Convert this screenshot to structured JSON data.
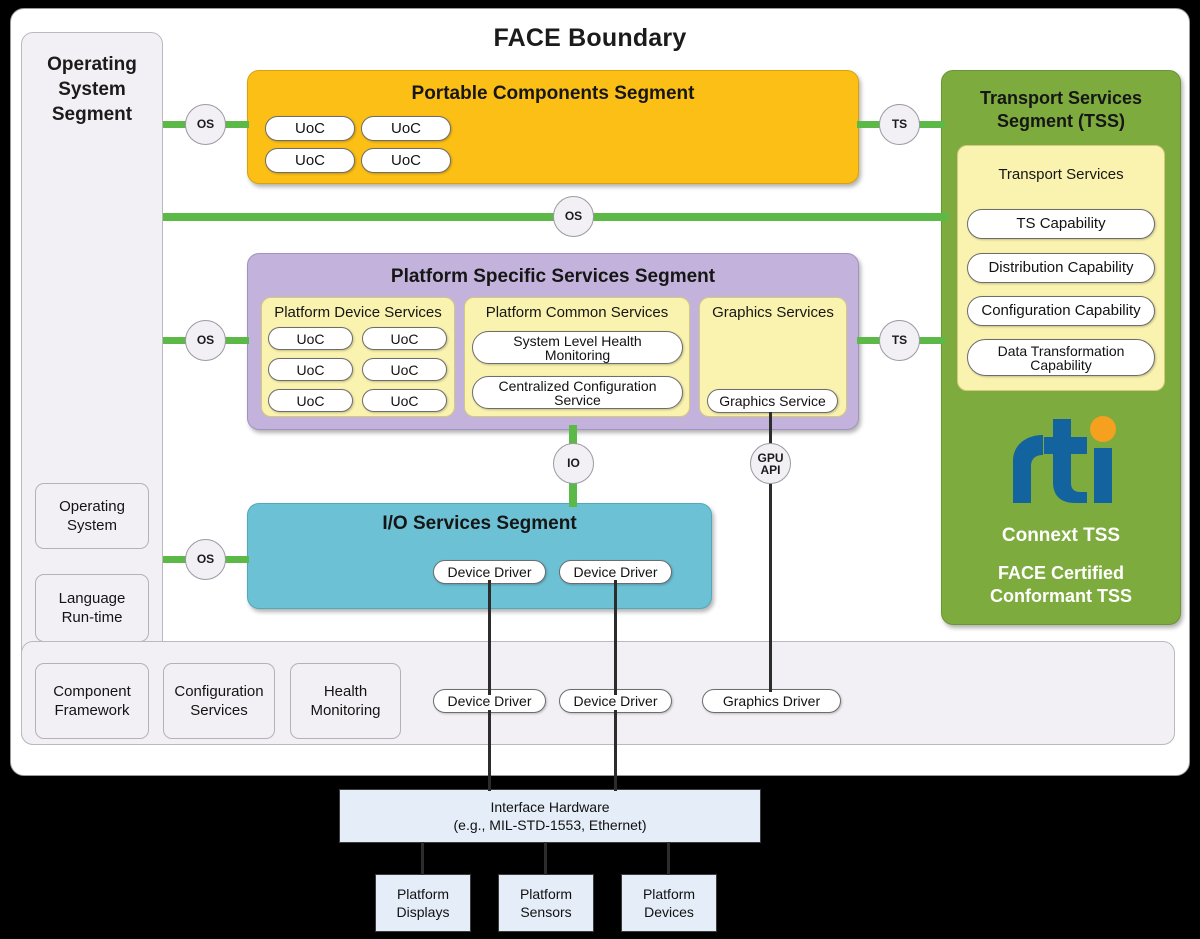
{
  "diagram": {
    "title": "FACE Boundary"
  },
  "operating_system_segment": {
    "title": "Operating\nSystem\nSegment",
    "title_line1": "Operating",
    "title_line2": "System",
    "title_line3": "Segment",
    "upper_items": [
      {
        "label": "Operating System",
        "line1": "Operating",
        "line2": "System"
      },
      {
        "label": "Language Run-time",
        "line1": "Language",
        "line2": "Run-time"
      }
    ],
    "bottom_items": [
      {
        "label": "Component Framework",
        "line1": "Component",
        "line2": "Framework"
      },
      {
        "label": "Configuration Services",
        "line1": "Configuration",
        "line2": "Services"
      },
      {
        "label": "Health Monitoring",
        "line1": "Health",
        "line2": "Monitoring"
      }
    ],
    "drivers": [
      {
        "label": "Device Driver"
      },
      {
        "label": "Device Driver"
      },
      {
        "label": "Graphics Driver"
      }
    ]
  },
  "portable_components_segment": {
    "title": "Portable Components Segment",
    "color": "#FCBF16",
    "uocs": [
      {
        "label": "UoC"
      },
      {
        "label": "UoC"
      },
      {
        "label": "UoC"
      },
      {
        "label": "UoC"
      }
    ]
  },
  "platform_specific_services_segment": {
    "title": "Platform Specific Services Segment",
    "color": "#C3B3DC",
    "groups": [
      {
        "title": "Platform Device Services",
        "items": [
          {
            "label": "UoC"
          },
          {
            "label": "UoC"
          },
          {
            "label": "UoC"
          },
          {
            "label": "UoC"
          },
          {
            "label": "UoC"
          },
          {
            "label": "UoC"
          }
        ]
      },
      {
        "title": "Platform Common Services",
        "items": [
          {
            "label": "System Level Health Monitoring",
            "line1": "System Level Health",
            "line2": "Monitoring"
          },
          {
            "label": "Centralized Configuration Service",
            "line1": "Centralized Configuration",
            "line2": "Service"
          }
        ]
      },
      {
        "title": "Graphics Services",
        "items": [
          {
            "label": "Graphics Service"
          }
        ]
      }
    ]
  },
  "io_services_segment": {
    "title": "I/O Services Segment",
    "color": "#6DC1D5",
    "drivers": [
      {
        "label": "Device Driver"
      },
      {
        "label": "Device Driver"
      }
    ]
  },
  "transport_services_segment": {
    "title_line1": "Transport Services",
    "title_line2": "Segment (TSS)",
    "color": "#7EAB3E",
    "inner_group_title": "Transport Services",
    "capabilities": [
      {
        "label": "TS Capability"
      },
      {
        "label": "Distribution Capability"
      },
      {
        "label": "Configuration Capability"
      },
      {
        "label": "Data Transformation Capability",
        "line1": "Data Transformation",
        "line2": "Capability"
      }
    ],
    "logo": {
      "name": "rti-logo",
      "wordmark": "rti",
      "blue": "#12639E",
      "orange": "#F5A01E"
    },
    "product_name": "Connext TSS",
    "certification_line1": "FACE Certified",
    "certification_line2": "Conformant TSS"
  },
  "connectors": [
    {
      "id": "os-portable",
      "label": "OS"
    },
    {
      "id": "os-bus",
      "label": "OS"
    },
    {
      "id": "os-pss",
      "label": "OS"
    },
    {
      "id": "os-io",
      "label": "OS"
    },
    {
      "id": "ts-portable",
      "label": "TS"
    },
    {
      "id": "ts-pss",
      "label": "TS"
    },
    {
      "id": "io-iface",
      "label": "IO"
    },
    {
      "id": "gpu-api",
      "label_line1": "GPU",
      "label_line2": "API"
    }
  ],
  "hardware": {
    "interface": {
      "line1": "Interface Hardware",
      "line2": "(e.g., MIL-STD-1553, Ethernet)"
    },
    "platform_blocks": [
      {
        "line1": "Platform",
        "line2": "Displays"
      },
      {
        "line1": "Platform",
        "line2": "Sensors"
      },
      {
        "line1": "Platform",
        "line2": "Devices"
      }
    ]
  },
  "colors": {
    "green_line": "#5CB947",
    "black_line": "#2c2c2c",
    "hardware_fill": "#E4EDF8",
    "yellow_group": "#FAF3AF"
  }
}
